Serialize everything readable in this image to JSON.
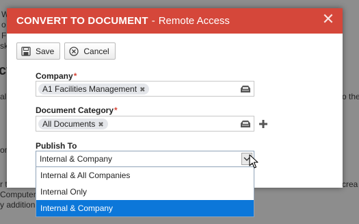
{
  "background": {
    "fragments": [
      "W",
      "o",
      "F",
      "sk",
      "ct",
      "al",
      "or",
      "r t",
      "Computer",
      "y addition",
      "o the",
      "crea"
    ]
  },
  "dialog": {
    "title": "CONVERT TO DOCUMENT",
    "separator": "-",
    "subtitle": "Remote Access",
    "close_glyph": "✕"
  },
  "toolbar": {
    "save_label": "Save",
    "cancel_label": "Cancel"
  },
  "form": {
    "company": {
      "label": "Company",
      "required_mark": "*",
      "tag": "A1 Facilities Management",
      "tag_remove": "✖"
    },
    "document_category": {
      "label": "Document Category",
      "required_mark": "*",
      "tag": "All Documents",
      "tag_remove": "✖"
    },
    "publish_to": {
      "label": "Publish To",
      "selected": "Internal & Company",
      "options": [
        "Internal & All Companies",
        "Internal Only",
        "Internal & Company"
      ],
      "highlighted_index": 2
    }
  },
  "colors": {
    "titlebar": "#d5473a",
    "selection": "#0c77d9"
  }
}
